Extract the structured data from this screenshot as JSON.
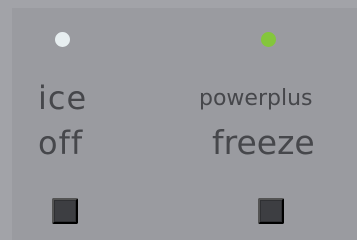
{
  "controls": [
    {
      "id": "ice-off",
      "indicator": {
        "state": "off",
        "color": "#e7eef0"
      },
      "label_line1": "ice",
      "label_line2": "off"
    },
    {
      "id": "powerplus-freeze",
      "indicator": {
        "state": "on",
        "color": "#84c63c"
      },
      "label_line1": "powerplus",
      "label_line2": "freeze"
    }
  ],
  "colors": {
    "background": "#a2a3a8",
    "panel": "#9a9ba0",
    "label_text": "#46474b",
    "button": "#3d3e42"
  }
}
